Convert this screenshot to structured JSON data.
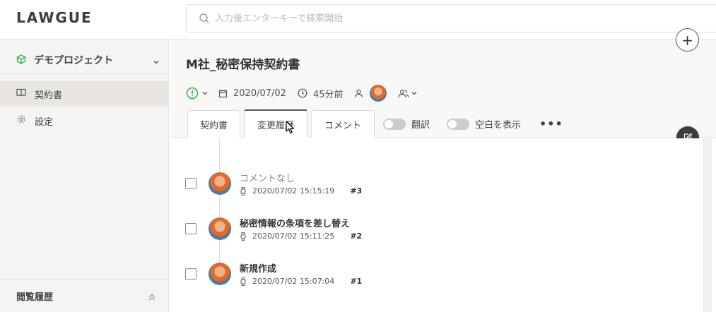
{
  "app": {
    "logo": "LAWGUE"
  },
  "search": {
    "placeholder": "入力後エンターキーで検索開始"
  },
  "sidebar": {
    "project": "デモプロジェクト",
    "items": [
      {
        "label": "契約書",
        "icon": "book-icon",
        "active": true
      },
      {
        "label": "設定",
        "icon": "gear-icon",
        "active": false
      }
    ],
    "history_label": "閲覧履歴"
  },
  "document": {
    "title": "M社_秘密保持契約書",
    "date": "2020/07/02",
    "elapsed": "45分前"
  },
  "tabs": [
    {
      "label": "契約書",
      "active": false
    },
    {
      "label": "変更履歴",
      "active": true
    },
    {
      "label": "コメント",
      "active": false
    }
  ],
  "toggles": [
    {
      "label": "翻訳",
      "on": false
    },
    {
      "label": "空白を表示",
      "on": false
    }
  ],
  "more_label": "•••",
  "plus_label": "+",
  "revisions": [
    {
      "title": "コメントなし",
      "timestamp": "2020/07/02 15:15:19",
      "number": "#3",
      "muted": true
    },
    {
      "title": "秘密情報の条項を差し替え",
      "timestamp": "2020/07/02 15:11:25",
      "number": "#2",
      "muted": false
    },
    {
      "title": "新規作成",
      "timestamp": "2020/07/02 15:07:04",
      "number": "#1",
      "muted": false
    }
  ],
  "colors": {
    "status_green": "#2db34a",
    "accent_dark": "#3d3d3d"
  }
}
